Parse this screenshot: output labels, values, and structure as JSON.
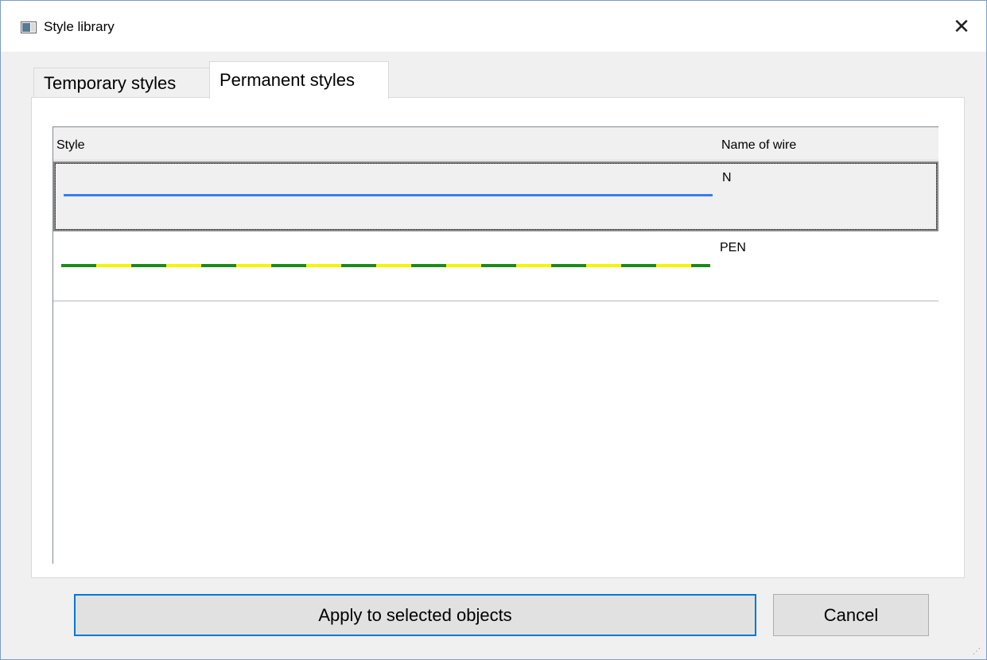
{
  "window": {
    "title": "Style library",
    "close_symbol": "✕",
    "icon": "window-app-icon"
  },
  "tabs": [
    {
      "label": "Temporary styles",
      "active": false
    },
    {
      "label": "Permanent styles",
      "active": true
    }
  ],
  "table": {
    "columns": [
      "Style",
      "Name of wire"
    ],
    "rows": [
      {
        "style": {
          "pattern": "solid",
          "colors": [
            "#3a7df0"
          ]
        },
        "name": "N",
        "selected": true
      },
      {
        "style": {
          "pattern": "dashed-alternating",
          "colors": [
            "#1a8a1a",
            "#f5f500"
          ]
        },
        "name": "PEN",
        "selected": false
      }
    ]
  },
  "buttons": {
    "apply": "Apply to selected objects",
    "cancel": "Cancel"
  },
  "colors": {
    "accent_focus": "#0078d7",
    "neutral_wire": "#3a7df0",
    "pen_green": "#1a8a1a",
    "pen_yellow": "#f5f500"
  }
}
